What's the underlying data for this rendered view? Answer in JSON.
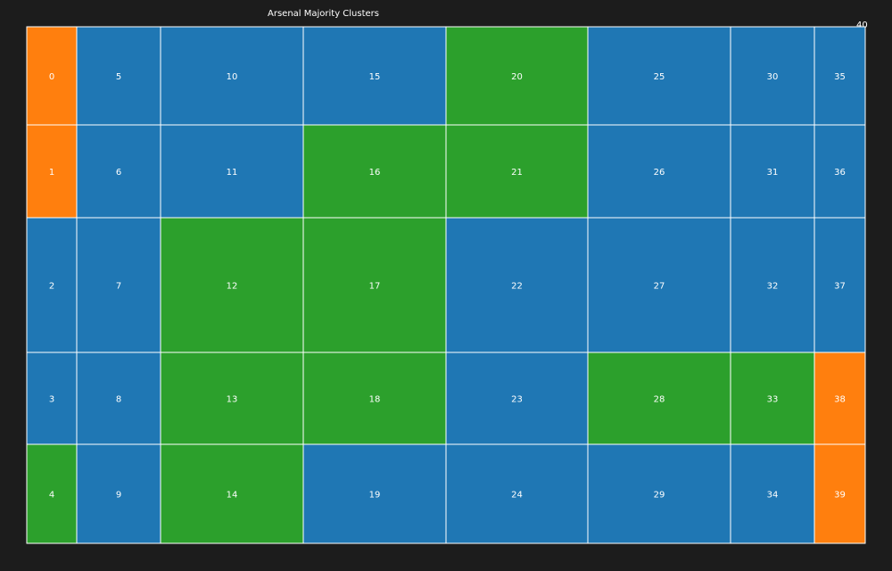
{
  "chart_data": {
    "type": "heatmap",
    "title": "Arsenal Majority Clusters",
    "corner_label": "40",
    "colors": {
      "background": "#1c1c1c",
      "blue": "#1f77b4",
      "orange": "#ff7f0e",
      "green": "#2ca02c",
      "cell_border": "#ffffff",
      "label": "#ffffff"
    },
    "columns": [
      {
        "rows": [
          {
            "label": "0",
            "color": "orange"
          },
          {
            "label": "1",
            "color": "orange"
          },
          {
            "label": "2",
            "color": "blue"
          },
          {
            "label": "3",
            "color": "blue"
          },
          {
            "label": "4",
            "color": "green"
          }
        ]
      },
      {
        "rows": [
          {
            "label": "5",
            "color": "blue"
          },
          {
            "label": "6",
            "color": "blue"
          },
          {
            "label": "7",
            "color": "blue"
          },
          {
            "label": "8",
            "color": "blue"
          },
          {
            "label": "9",
            "color": "blue"
          }
        ]
      },
      {
        "rows": [
          {
            "label": "10",
            "color": "blue"
          },
          {
            "label": "11",
            "color": "blue"
          },
          {
            "label": "12",
            "color": "green"
          },
          {
            "label": "13",
            "color": "green"
          },
          {
            "label": "14",
            "color": "green"
          }
        ]
      },
      {
        "rows": [
          {
            "label": "15",
            "color": "blue"
          },
          {
            "label": "16",
            "color": "green"
          },
          {
            "label": "17",
            "color": "green"
          },
          {
            "label": "18",
            "color": "green"
          },
          {
            "label": "19",
            "color": "blue"
          }
        ]
      },
      {
        "rows": [
          {
            "label": "20",
            "color": "green"
          },
          {
            "label": "21",
            "color": "green"
          },
          {
            "label": "22",
            "color": "blue"
          },
          {
            "label": "23",
            "color": "blue"
          },
          {
            "label": "24",
            "color": "blue"
          }
        ]
      },
      {
        "rows": [
          {
            "label": "25",
            "color": "blue"
          },
          {
            "label": "26",
            "color": "blue"
          },
          {
            "label": "27",
            "color": "blue"
          },
          {
            "label": "28",
            "color": "green"
          },
          {
            "label": "29",
            "color": "blue"
          }
        ]
      },
      {
        "rows": [
          {
            "label": "30",
            "color": "blue"
          },
          {
            "label": "31",
            "color": "blue"
          },
          {
            "label": "32",
            "color": "blue"
          },
          {
            "label": "33",
            "color": "green"
          },
          {
            "label": "34",
            "color": "blue"
          }
        ]
      },
      {
        "rows": [
          {
            "label": "35",
            "color": "blue"
          },
          {
            "label": "36",
            "color": "blue"
          },
          {
            "label": "37",
            "color": "blue"
          },
          {
            "label": "38",
            "color": "orange"
          },
          {
            "label": "39",
            "color": "orange"
          }
        ]
      }
    ]
  }
}
